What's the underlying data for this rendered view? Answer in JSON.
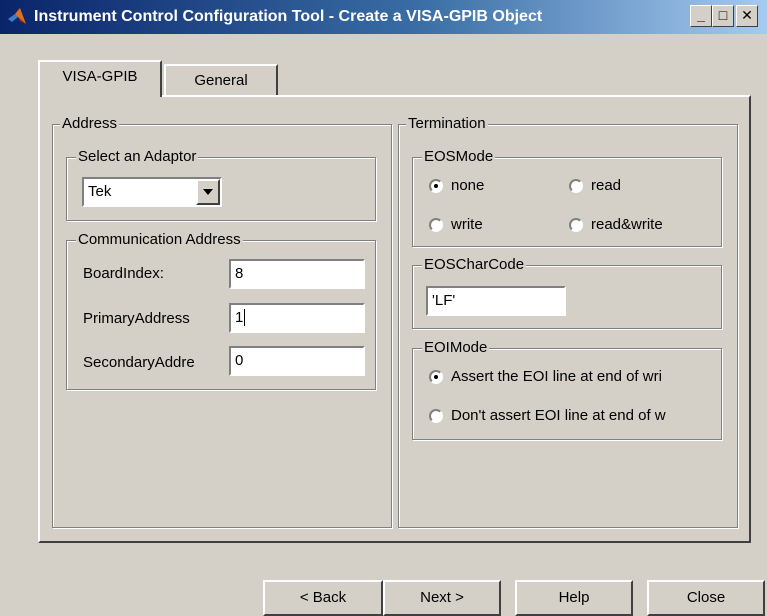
{
  "window": {
    "title": "Instrument Control Configuration Tool - Create a VISA-GPIB Object",
    "minimize_glyph": "_",
    "maximize_glyph": "□",
    "close_glyph": "✕"
  },
  "tabs": [
    {
      "label": "VISA-GPIB",
      "active": true
    },
    {
      "label": "General",
      "active": false
    }
  ],
  "address": {
    "legend": "Address",
    "adaptor": {
      "legend": "Select an Adaptor",
      "selected": "Tek"
    },
    "comm": {
      "legend": "Communication Address",
      "board_label": "BoardIndex:",
      "board_value": "8",
      "primary_label": "PrimaryAddress",
      "primary_value": "1",
      "secondary_label": "SecondaryAddre",
      "secondary_value": "0"
    }
  },
  "termination": {
    "legend": "Termination",
    "eosmode": {
      "legend": "EOSMode",
      "options": [
        "none",
        "read",
        "write",
        "read&write"
      ],
      "selected": "none"
    },
    "eoscharcode": {
      "legend": "EOSCharCode",
      "value": "'LF'"
    },
    "eoimode": {
      "legend": "EOIMode",
      "options": [
        "Assert the EOI line at end of wri",
        "Don't assert EOI line at end of w"
      ],
      "selected": "Assert the EOI line at end of wri"
    }
  },
  "buttons": {
    "back": "< Back",
    "next": "Next >",
    "help": "Help",
    "close": "Close"
  },
  "colors": {
    "face": "#d4d0c8",
    "title_start": "#0a246a",
    "title_end": "#a6caf0"
  }
}
